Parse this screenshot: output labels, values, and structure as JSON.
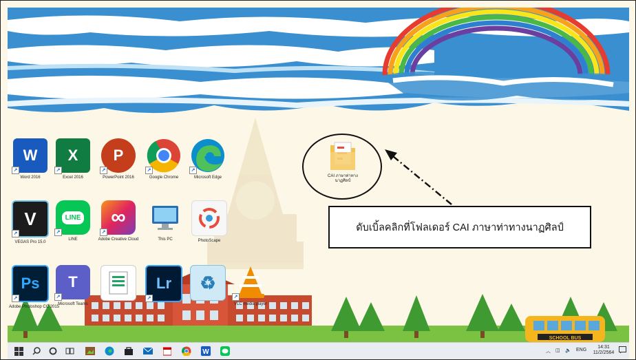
{
  "desktop_icons": [
    {
      "label": "Word 2016",
      "icon": "word-icon",
      "color": "#185abd",
      "glyph": "W"
    },
    {
      "label": "Excel 2016",
      "icon": "excel-icon",
      "color": "#107c41",
      "glyph": "X"
    },
    {
      "label": "PowerPoint 2016",
      "icon": "powerpoint-icon",
      "color": "#c43e1c",
      "glyph": "P"
    },
    {
      "label": "Google Chrome",
      "icon": "chrome-icon",
      "color": "#4285f4",
      "glyph": ""
    },
    {
      "label": "Microsoft Edge",
      "icon": "edge-icon",
      "color": "#0c8ecd",
      "glyph": ""
    },
    {
      "label": "VEGAS Pro 15.0",
      "icon": "vegas-icon",
      "color": "#1c1c1c",
      "glyph": "V"
    },
    {
      "label": "LINE",
      "icon": "line-icon",
      "color": "#06c755",
      "glyph": "LINE"
    },
    {
      "label": "Adobe Creative Cloud",
      "icon": "creative-cloud-icon",
      "color": "#e0245e",
      "glyph": "∞"
    },
    {
      "label": "This PC",
      "icon": "this-pc-icon",
      "color": "#6fb3e8",
      "glyph": ""
    },
    {
      "label": "PhotoScape",
      "icon": "photoscape-icon",
      "color": "#f2f2f2",
      "glyph": ""
    },
    {
      "label": "Adobe Photoshop CC 2015",
      "icon": "photoshop-icon",
      "color": "#001e36",
      "glyph": "Ps"
    },
    {
      "label": "Microsoft Teams",
      "icon": "teams-icon",
      "color": "#5b5fc7",
      "glyph": "T"
    },
    {
      "label": "",
      "icon": "spreadsheet-file-icon",
      "color": "#e8e0c0",
      "glyph": ""
    },
    {
      "label": "",
      "icon": "lightroom-icon",
      "color": "#001a33",
      "glyph": "Lr"
    },
    {
      "label": "",
      "icon": "recycle-bin-icon",
      "color": "#9fd0ea",
      "glyph": "♻"
    },
    {
      "label": "VLC media player",
      "icon": "vlc-icon",
      "color": "#f08c00",
      "glyph": ""
    }
  ],
  "folder": {
    "label": "CAI ภาษาท่าทางนาฏศิลป์",
    "icon": "folder-icon"
  },
  "callout": {
    "text": "ดับเบิ้ลคลิกที่โฟลเดอร์ CAI ภาษาท่าทางนาฏศิลป์"
  },
  "scenery": {
    "bus_text": "SCHOOL BUS",
    "sky_color": "#3a8fd0",
    "rainbow": [
      "#e63b2e",
      "#f7a21b",
      "#f8e51a",
      "#49b847",
      "#2f7fd1",
      "#6b3fa0"
    ]
  },
  "taskbar": {
    "apps": [
      "start-icon",
      "search-icon",
      "cortana-icon",
      "task-view-icon",
      "photos-icon",
      "edge-icon",
      "store-icon",
      "mail-icon",
      "calendar-icon",
      "chrome-icon",
      "word-icon",
      "line-icon"
    ],
    "tray": {
      "language": "ENG",
      "time": "14:31",
      "date": "11/2/2564"
    }
  }
}
